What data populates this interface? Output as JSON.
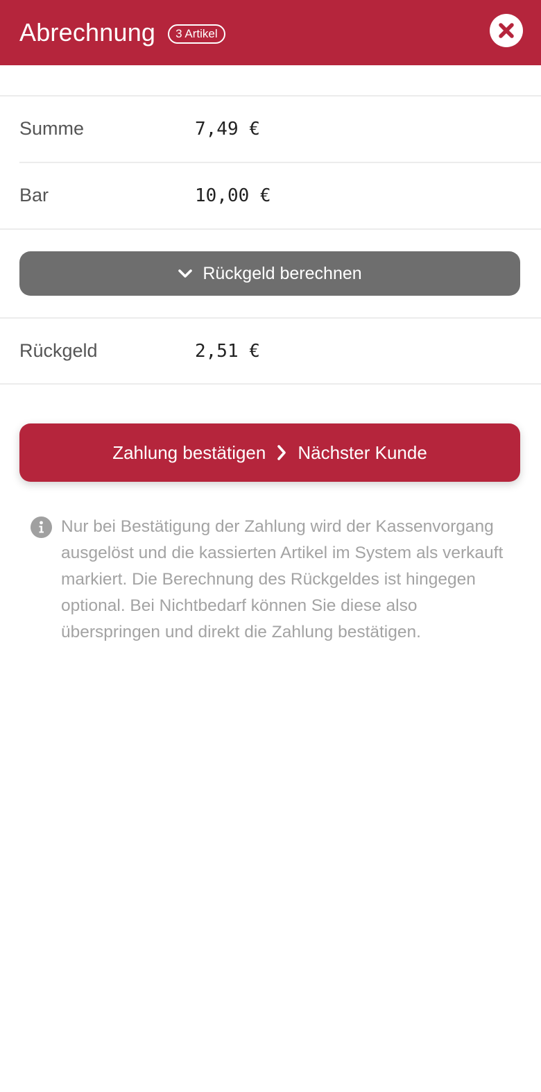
{
  "header": {
    "title": "Abrechnung",
    "badge": "3 Artikel",
    "close_icon": "close-icon",
    "background_color": "#b5253c"
  },
  "rows": [
    {
      "label": "Summe",
      "value": "7,49 €"
    },
    {
      "label": "Bar",
      "value": "10,00 €"
    }
  ],
  "calc_button": {
    "icon": "chevron-down-icon",
    "label": "Rückgeld berechnen",
    "color": "#6e6e6e"
  },
  "change_row": {
    "label": "Rückgeld",
    "value": "2,51 €"
  },
  "confirm_button": {
    "label_left": "Zahlung bestätigen",
    "icon": "chevron-right-icon",
    "label_right": "Nächster Kunde",
    "color": "#b5253c"
  },
  "info": {
    "icon": "info-icon",
    "text": "Nur bei Bestätigung der Zahlung wird der Kassenvorgang ausgelöst und die kassierten Artikel im System als verkauft markiert. Die Berechnung des Rückgeldes ist hingegen optional. Bei Nichtbedarf können Sie diese also überspringen und direkt die Zahlung bestätigen."
  }
}
